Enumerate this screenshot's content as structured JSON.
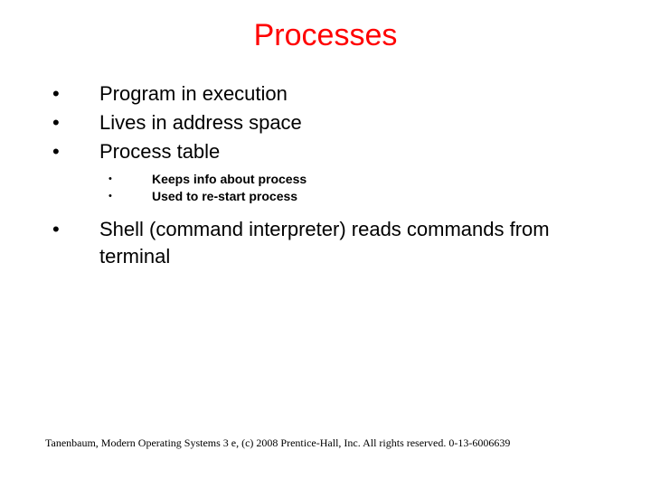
{
  "title": "Processes",
  "bullets": {
    "b0": "Program in execution",
    "b1": "Lives in address space",
    "b2": "Process table",
    "b3": "Shell (command interpreter) reads commands from terminal"
  },
  "subbullets": {
    "s0": "Keeps info about process",
    "s1": "Used to re-start process"
  },
  "footer": "Tanenbaum, Modern Operating Systems 3 e, (c) 2008 Prentice-Hall, Inc. All rights reserved. 0-13-6006639",
  "glyphs": {
    "bullet": "•",
    "subbullet": "•"
  }
}
